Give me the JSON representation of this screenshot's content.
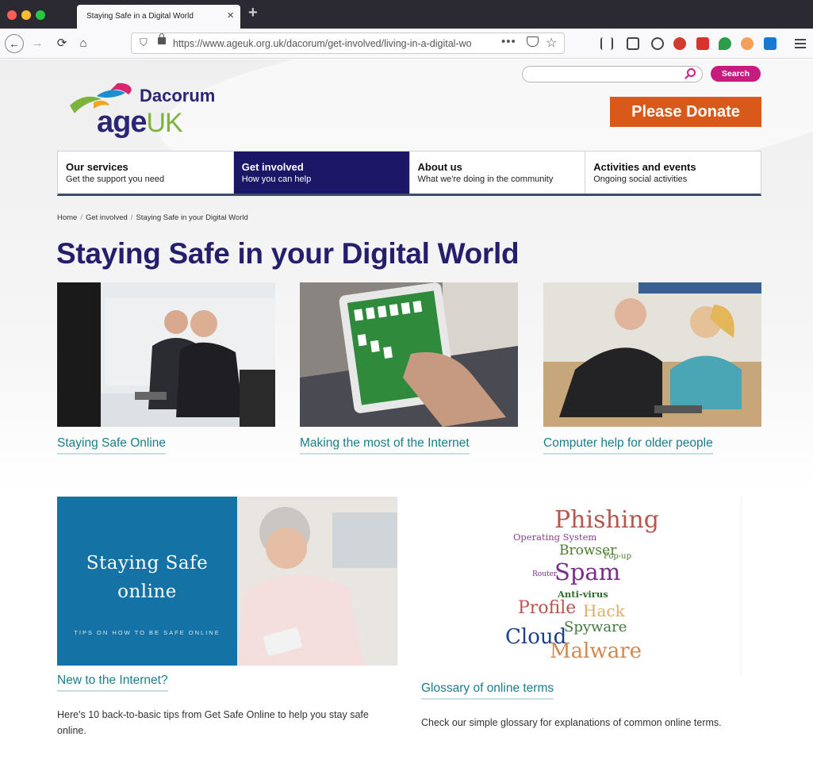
{
  "browser": {
    "tab_title": "Staying Safe in a Digital World",
    "tab_close": "×",
    "new_tab": "+",
    "url": "https://www.ageuk.org.uk/dacorum/get-involved/living-in-a-digital-wo",
    "url_more": "•••"
  },
  "site": {
    "logo_name": "Dacorum",
    "logo_word_main": "age",
    "logo_word_accent": "UK",
    "search_placeholder": "",
    "search_button": "Search",
    "donate_button": "Please Donate"
  },
  "nav": [
    {
      "title": "Our services",
      "sub": "Get the support you need"
    },
    {
      "title": "Get involved",
      "sub": "How you can help"
    },
    {
      "title": "About us",
      "sub": "What we're doing in the community"
    },
    {
      "title": "Activities and events",
      "sub": "Ongoing social activities"
    }
  ],
  "breadcrumb": {
    "home": "Home",
    "sep": "/",
    "section": "Get involved",
    "current": "Staying Safe in your Digital World"
  },
  "page_title": "Staying Safe in your Digital World",
  "cards": [
    {
      "link": "Staying Safe Online"
    },
    {
      "link": "Making the most of the Internet"
    },
    {
      "link": "Computer help for older people"
    }
  ],
  "promo": {
    "title_line1": "Staying Safe",
    "title_line2": "online",
    "subtitle": "TIPS ON HOW TO BE SAFE ONLINE"
  },
  "wordcloud": {
    "words": [
      "Phishing",
      "Operating System",
      "Browser",
      "Pop-up",
      "Router",
      "Spam",
      "Anti-virus",
      "Profile",
      "Hack",
      "Spyware",
      "Cloud",
      "Malware"
    ],
    "colors": {
      "phishing": "#b5574f",
      "spam": "#7a2d8a",
      "browser": "#4c7b2c",
      "profile": "#b5574f",
      "hack": "#d9b06a",
      "spyware": "#3f7a3a",
      "cloud": "#1b3f8a",
      "malware": "#d08a4f"
    }
  },
  "lower": [
    {
      "link": "New to the Internet?",
      "desc": "Here's 10 back-to-basic tips from Get Safe Online to help you stay safe online."
    },
    {
      "link": "Glossary of online terms",
      "desc": "Check our simple glossary for explanations of common online terms."
    }
  ],
  "colors": {
    "brand_navy": "#241e6d",
    "brand_green": "#7bb33d",
    "donate_orange": "#d9591b",
    "search_magenta": "#c61c80",
    "link_teal": "#1a7d8a",
    "promo_blue": "#1572a5"
  }
}
